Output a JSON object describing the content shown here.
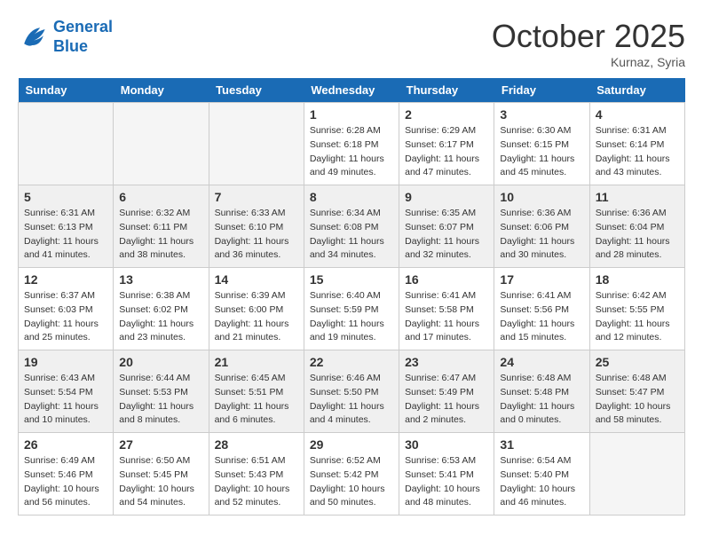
{
  "header": {
    "logo_line1": "General",
    "logo_line2": "Blue",
    "month": "October 2025",
    "location": "Kurnaz, Syria"
  },
  "days_of_week": [
    "Sunday",
    "Monday",
    "Tuesday",
    "Wednesday",
    "Thursday",
    "Friday",
    "Saturday"
  ],
  "weeks": [
    [
      {
        "num": "",
        "info": ""
      },
      {
        "num": "",
        "info": ""
      },
      {
        "num": "",
        "info": ""
      },
      {
        "num": "1",
        "info": "Sunrise: 6:28 AM\nSunset: 6:18 PM\nDaylight: 11 hours\nand 49 minutes."
      },
      {
        "num": "2",
        "info": "Sunrise: 6:29 AM\nSunset: 6:17 PM\nDaylight: 11 hours\nand 47 minutes."
      },
      {
        "num": "3",
        "info": "Sunrise: 6:30 AM\nSunset: 6:15 PM\nDaylight: 11 hours\nand 45 minutes."
      },
      {
        "num": "4",
        "info": "Sunrise: 6:31 AM\nSunset: 6:14 PM\nDaylight: 11 hours\nand 43 minutes."
      }
    ],
    [
      {
        "num": "5",
        "info": "Sunrise: 6:31 AM\nSunset: 6:13 PM\nDaylight: 11 hours\nand 41 minutes."
      },
      {
        "num": "6",
        "info": "Sunrise: 6:32 AM\nSunset: 6:11 PM\nDaylight: 11 hours\nand 38 minutes."
      },
      {
        "num": "7",
        "info": "Sunrise: 6:33 AM\nSunset: 6:10 PM\nDaylight: 11 hours\nand 36 minutes."
      },
      {
        "num": "8",
        "info": "Sunrise: 6:34 AM\nSunset: 6:08 PM\nDaylight: 11 hours\nand 34 minutes."
      },
      {
        "num": "9",
        "info": "Sunrise: 6:35 AM\nSunset: 6:07 PM\nDaylight: 11 hours\nand 32 minutes."
      },
      {
        "num": "10",
        "info": "Sunrise: 6:36 AM\nSunset: 6:06 PM\nDaylight: 11 hours\nand 30 minutes."
      },
      {
        "num": "11",
        "info": "Sunrise: 6:36 AM\nSunset: 6:04 PM\nDaylight: 11 hours\nand 28 minutes."
      }
    ],
    [
      {
        "num": "12",
        "info": "Sunrise: 6:37 AM\nSunset: 6:03 PM\nDaylight: 11 hours\nand 25 minutes."
      },
      {
        "num": "13",
        "info": "Sunrise: 6:38 AM\nSunset: 6:02 PM\nDaylight: 11 hours\nand 23 minutes."
      },
      {
        "num": "14",
        "info": "Sunrise: 6:39 AM\nSunset: 6:00 PM\nDaylight: 11 hours\nand 21 minutes."
      },
      {
        "num": "15",
        "info": "Sunrise: 6:40 AM\nSunset: 5:59 PM\nDaylight: 11 hours\nand 19 minutes."
      },
      {
        "num": "16",
        "info": "Sunrise: 6:41 AM\nSunset: 5:58 PM\nDaylight: 11 hours\nand 17 minutes."
      },
      {
        "num": "17",
        "info": "Sunrise: 6:41 AM\nSunset: 5:56 PM\nDaylight: 11 hours\nand 15 minutes."
      },
      {
        "num": "18",
        "info": "Sunrise: 6:42 AM\nSunset: 5:55 PM\nDaylight: 11 hours\nand 12 minutes."
      }
    ],
    [
      {
        "num": "19",
        "info": "Sunrise: 6:43 AM\nSunset: 5:54 PM\nDaylight: 11 hours\nand 10 minutes."
      },
      {
        "num": "20",
        "info": "Sunrise: 6:44 AM\nSunset: 5:53 PM\nDaylight: 11 hours\nand 8 minutes."
      },
      {
        "num": "21",
        "info": "Sunrise: 6:45 AM\nSunset: 5:51 PM\nDaylight: 11 hours\nand 6 minutes."
      },
      {
        "num": "22",
        "info": "Sunrise: 6:46 AM\nSunset: 5:50 PM\nDaylight: 11 hours\nand 4 minutes."
      },
      {
        "num": "23",
        "info": "Sunrise: 6:47 AM\nSunset: 5:49 PM\nDaylight: 11 hours\nand 2 minutes."
      },
      {
        "num": "24",
        "info": "Sunrise: 6:48 AM\nSunset: 5:48 PM\nDaylight: 11 hours\nand 0 minutes."
      },
      {
        "num": "25",
        "info": "Sunrise: 6:48 AM\nSunset: 5:47 PM\nDaylight: 10 hours\nand 58 minutes."
      }
    ],
    [
      {
        "num": "26",
        "info": "Sunrise: 6:49 AM\nSunset: 5:46 PM\nDaylight: 10 hours\nand 56 minutes."
      },
      {
        "num": "27",
        "info": "Sunrise: 6:50 AM\nSunset: 5:45 PM\nDaylight: 10 hours\nand 54 minutes."
      },
      {
        "num": "28",
        "info": "Sunrise: 6:51 AM\nSunset: 5:43 PM\nDaylight: 10 hours\nand 52 minutes."
      },
      {
        "num": "29",
        "info": "Sunrise: 6:52 AM\nSunset: 5:42 PM\nDaylight: 10 hours\nand 50 minutes."
      },
      {
        "num": "30",
        "info": "Sunrise: 6:53 AM\nSunset: 5:41 PM\nDaylight: 10 hours\nand 48 minutes."
      },
      {
        "num": "31",
        "info": "Sunrise: 6:54 AM\nSunset: 5:40 PM\nDaylight: 10 hours\nand 46 minutes."
      },
      {
        "num": "",
        "info": ""
      }
    ]
  ]
}
